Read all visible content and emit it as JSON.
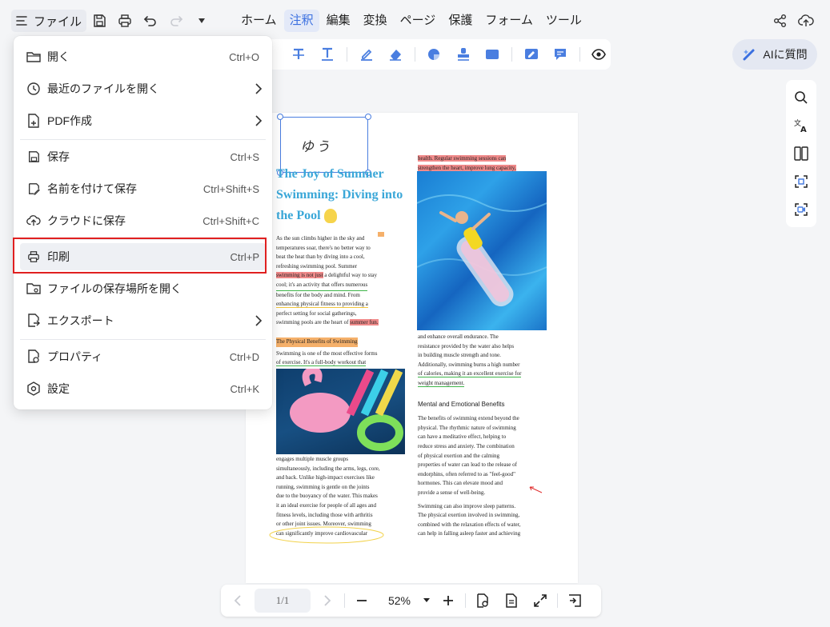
{
  "topbar": {
    "file_label": "ファイル",
    "menu_tabs": [
      "ホーム",
      "注釈",
      "編集",
      "変換",
      "ページ",
      "保護",
      "フォーム",
      "ツール"
    ],
    "active_tab": "注釈",
    "ai_label": "AIに質問"
  },
  "file_menu": {
    "items": [
      {
        "label": "開く",
        "shortcut": "Ctrl+O"
      },
      {
        "label": "最近のファイルを開く",
        "shortcut": ""
      },
      {
        "label": "PDF作成",
        "shortcut": ""
      },
      {
        "label": "保存",
        "shortcut": "Ctrl+S"
      },
      {
        "label": "名前を付けて保存",
        "shortcut": "Ctrl+Shift+S"
      },
      {
        "label": "クラウドに保存",
        "shortcut": "Ctrl+Shift+C"
      },
      {
        "label": "印刷",
        "shortcut": "Ctrl+P"
      },
      {
        "label": "ファイルの保存場所を開く",
        "shortcut": ""
      },
      {
        "label": "エクスポート",
        "shortcut": ""
      },
      {
        "label": "プロパティ",
        "shortcut": "Ctrl+D"
      },
      {
        "label": "設定",
        "shortcut": "Ctrl+K"
      }
    ],
    "highlighted": "印刷"
  },
  "document": {
    "handwriting": "ゆう",
    "title_lines": [
      "The Joy of Summer",
      "Swimming: Diving into",
      "the Pool"
    ],
    "left_col": {
      "p1": [
        "As the sun climbs higher in the sky and",
        "temperatures soar, there's no better way to",
        "beat the heat than by diving into a cool,",
        "refreshing swimming pool. Summer"
      ],
      "p1_hl": "swimming is not just",
      "p1_after": " a delightful way to stay",
      "p1_rest": [
        "cool; it's an activity that offers numerous",
        "benefits for the body and mind. From",
        "enhancing physical fitness to providing a",
        "perfect setting for social gatherings,"
      ],
      "p1_last": "swimming pools are the heart of ",
      "p1_last_hl": "summer fun.",
      "heading": "The Physical Benefits of Swimming",
      "p2": [
        "Swimming is one of the most effective forms",
        "of exercise. It's a full-body workout that"
      ],
      "p3": [
        "engages multiple muscle groups",
        "simultaneously, including the arms, legs, core,",
        "and back. Unlike high-impact exercises like",
        "running, swimming is gentle on the joints",
        "due to the buoyancy of the water. This makes",
        "it an ideal exercise for people of all ages and",
        "fitness levels, including those with arthritis",
        "or other joint issues. Moreover, swimming",
        "can significantly improve cardiovascular"
      ]
    },
    "right_col": {
      "top_hl": [
        "health. Regular swimming sessions can",
        "strengthen the heart, improve lung capacity,"
      ],
      "p1": [
        "and enhance overall endurance. The",
        "resistance provided by the water also helps",
        "in building muscle strength and tone.",
        "Additionally, swimming burns a high number",
        "of calories, making it an excellent exercise for",
        "weight management."
      ],
      "heading": "Mental and Emotional Benefits",
      "p2": [
        "The benefits of swimming extend beyond the",
        "physical. The rhythmic nature of swimming",
        "can have a meditative effect, helping to",
        "reduce stress and anxiety. The combination",
        "of physical exertion and the calming",
        "properties of water can lead to the release of",
        "endorphins, often referred to as \"feel-good\"",
        "hormones. This can elevate mood and",
        "provide a sense of well-being."
      ],
      "p3": [
        "Swimming can also improve sleep patterns.",
        "The physical exertion involved in swimming,",
        "combined with the relaxation effects of water,",
        "can help in falling asleep faster and achieving"
      ]
    }
  },
  "bottombar": {
    "page_indicator": "1/1",
    "zoom": "52%"
  },
  "colors": {
    "accent": "#3a6fe0",
    "highlight_red": "#f08a8a",
    "highlight_orange": "#f5b06a",
    "title_blue": "#3aa7d8",
    "frame_red": "#e02020"
  }
}
